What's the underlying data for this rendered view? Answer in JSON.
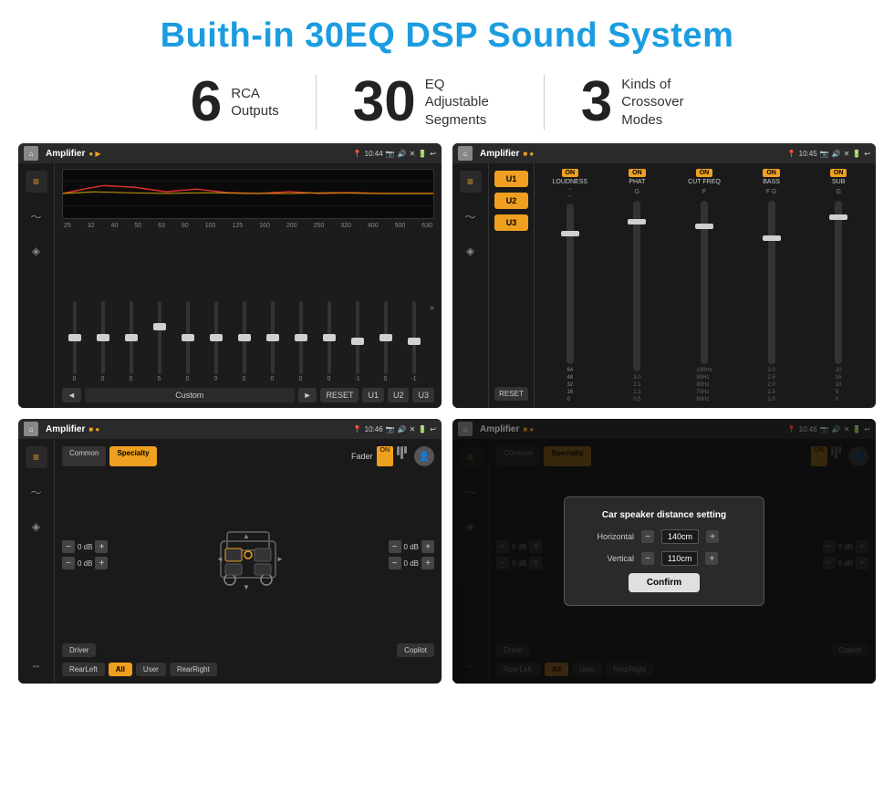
{
  "header": {
    "title": "Buith-in 30EQ DSP Sound System"
  },
  "stats": [
    {
      "number": "6",
      "label": "RCA\nOutputs"
    },
    {
      "number": "30",
      "label": "EQ Adjustable\nSegments"
    },
    {
      "number": "3",
      "label": "Kinds of\nCrossover Modes"
    }
  ],
  "screens": {
    "eq_screen": {
      "status_bar": {
        "app": "Amplifier",
        "time": "10:44"
      },
      "freq_labels": [
        "25",
        "32",
        "40",
        "50",
        "63",
        "80",
        "100",
        "125",
        "160",
        "200",
        "250",
        "320",
        "400",
        "500",
        "630"
      ],
      "slider_values": [
        "0",
        "0",
        "0",
        "5",
        "0",
        "0",
        "0",
        "0",
        "0",
        "0",
        "-1",
        "0",
        "-1"
      ],
      "buttons": [
        "◄",
        "Custom",
        "►",
        "RESET",
        "U1",
        "U2",
        "U3"
      ]
    },
    "amp_screen": {
      "status_bar": {
        "app": "Amplifier",
        "time": "10:45"
      },
      "u_buttons": [
        "U1",
        "U2",
        "U3"
      ],
      "channels": [
        {
          "label": "LOUDNESS",
          "on": true
        },
        {
          "label": "PHAT",
          "on": true
        },
        {
          "label": "CUT FREQ",
          "on": true
        },
        {
          "label": "BASS",
          "on": true
        },
        {
          "label": "SUB",
          "on": true
        }
      ],
      "reset": "RESET"
    },
    "fader_screen": {
      "status_bar": {
        "app": "Amplifier",
        "time": "10:46"
      },
      "tabs": [
        "Common",
        "Specialty"
      ],
      "fader_label": "Fader",
      "fader_on": "ON",
      "db_values": [
        "0 dB",
        "0 dB",
        "0 dB",
        "0 dB"
      ],
      "buttons": [
        "Driver",
        "RearLeft",
        "All",
        "User",
        "RearRight",
        "Copilot"
      ]
    },
    "dialog_screen": {
      "status_bar": {
        "app": "Amplifier",
        "time": "10:46"
      },
      "tabs": [
        "Common",
        "Specialty"
      ],
      "dialog": {
        "title": "Car speaker distance setting",
        "horizontal_label": "Horizontal",
        "horizontal_value": "140cm",
        "vertical_label": "Vertical",
        "vertical_value": "110cm",
        "confirm_label": "Confirm"
      },
      "db_values": [
        "0 dB",
        "0 dB"
      ],
      "buttons": [
        "Driver",
        "RearLeft.",
        "All",
        "User",
        "RearRight",
        "Copilot"
      ]
    }
  }
}
